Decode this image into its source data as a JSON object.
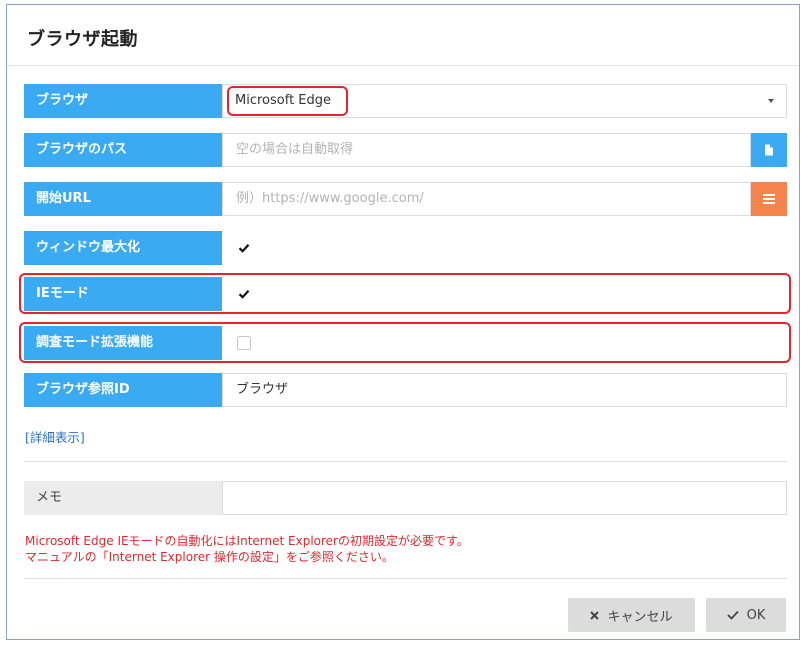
{
  "dialog": {
    "title": "ブラウザ起動"
  },
  "fields": {
    "browser": {
      "label": "ブラウザ",
      "value": "Microsoft Edge"
    },
    "browser_path": {
      "label": "ブラウザのパス",
      "placeholder": "空の場合は自動取得",
      "button_icon": "file-icon"
    },
    "start_url": {
      "label": "開始URL",
      "placeholder": "例）https://www.google.com/",
      "button_icon": "list-icon"
    },
    "maximize_window": {
      "label": "ウィンドウ最大化",
      "checked": true
    },
    "ie_mode": {
      "label": "IEモード",
      "checked": true
    },
    "debug_extension": {
      "label": "調査モード拡張機能",
      "checked": false
    },
    "browser_ref_id": {
      "label": "ブラウザ参照ID",
      "value": "ブラウザ"
    }
  },
  "detail_link": "[詳細表示]",
  "memo": {
    "label": "メモ",
    "value": ""
  },
  "warning": {
    "line1": "Microsoft Edge IEモードの自動化にはInternet Explorerの初期設定が必要です。",
    "line2": "マニュアルの「Internet Explorer 操作の設定」をご参照ください。"
  },
  "buttons": {
    "cancel": "キャンセル",
    "ok": "OK"
  },
  "colors": {
    "label_blue": "#3aaaf2",
    "orange_button": "#f7834d",
    "highlight_red": "#e3262e",
    "link_blue": "#2e6fc4"
  }
}
